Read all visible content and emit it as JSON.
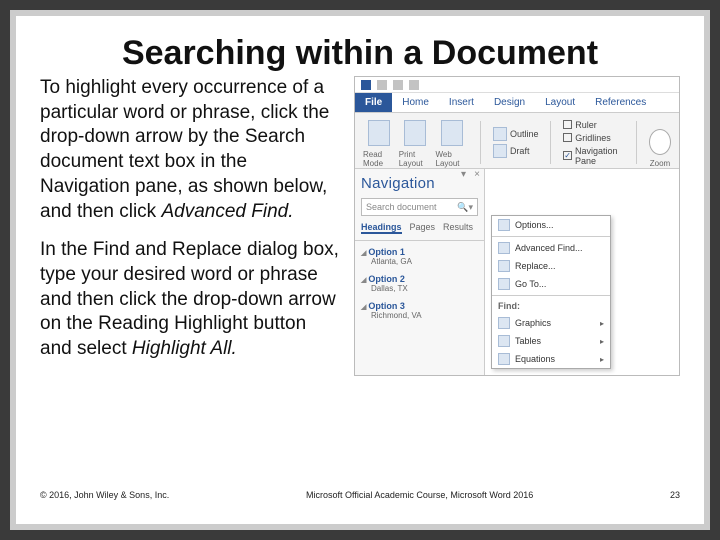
{
  "slide": {
    "title": "Searching within a Document",
    "para1_a": "To highlight every occurrence of a particular word or phrase, click the drop-down arrow by the Search document text box in the Navigation pane, as shown below, and then click ",
    "para1_b": "Advanced Find.",
    "para2_a": "In the Find and Replace dialog box, type your desired word or phrase and then click the drop-down arrow on the Reading Highlight button and select ",
    "para2_b": "Highlight All."
  },
  "footer": {
    "left": "© 2016, John Wiley & Sons, Inc.",
    "center": "Microsoft Official Academic Course, Microsoft Word 2016",
    "page": "23"
  },
  "word": {
    "tabs": {
      "file": "File",
      "home": "Home",
      "insert": "Insert",
      "design": "Design",
      "layout": "Layout",
      "references": "References"
    },
    "ribbon": {
      "views": {
        "read": "Read Mode",
        "print": "Print Layout",
        "web": "Web Layout",
        "outline": "Outline",
        "draft": "Draft"
      },
      "show": {
        "ruler": "Ruler",
        "gridlines": "Gridlines",
        "navpane": "Navigation Pane"
      },
      "zoom": "Zoom"
    },
    "nav": {
      "title": "Navigation",
      "search_placeholder": "Search document",
      "tabs": {
        "headings": "Headings",
        "pages": "Pages",
        "results": "Results"
      },
      "items": [
        {
          "h": "Option 1",
          "s": "Atlanta, GA"
        },
        {
          "h": "Option 2",
          "s": "Dallas, TX"
        },
        {
          "h": "Option 3",
          "s": "Richmond, VA"
        }
      ]
    },
    "flyout": {
      "options": "Options...",
      "advanced": "Advanced Find...",
      "replace": "Replace...",
      "goto": "Go To...",
      "find_hdr": "Find:",
      "graphics": "Graphics",
      "tables": "Tables",
      "equations": "Equations"
    }
  }
}
